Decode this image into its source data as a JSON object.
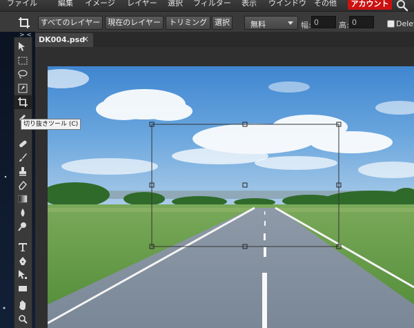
{
  "menu": {
    "items": [
      "ファイル",
      "編集",
      "イメージ",
      "レイヤー",
      "選択",
      "フィルター",
      "表示",
      "ウインドウ",
      "その他"
    ],
    "account_label": "アカウント"
  },
  "options": {
    "all_layers_label": "すべてのレイヤー",
    "current_layer_label": "現在のレイヤー",
    "trim_label": "トリミング",
    "select_label": "選択",
    "ratio_value": "無料",
    "width_label": "幅:",
    "width_value": "0",
    "height_label": "高:",
    "height_value": "0",
    "delete_label": "Delet"
  },
  "toolbox": {
    "grip": "> <",
    "tooltip": "切り抜きツール (C)"
  },
  "document": {
    "tab_label": "DK004.psd",
    "close_glyph": "✕"
  },
  "colors": {
    "accent_red": "#cc1111",
    "panel": "#3a3a3a",
    "canvas_bg": "#2f2f2f"
  }
}
